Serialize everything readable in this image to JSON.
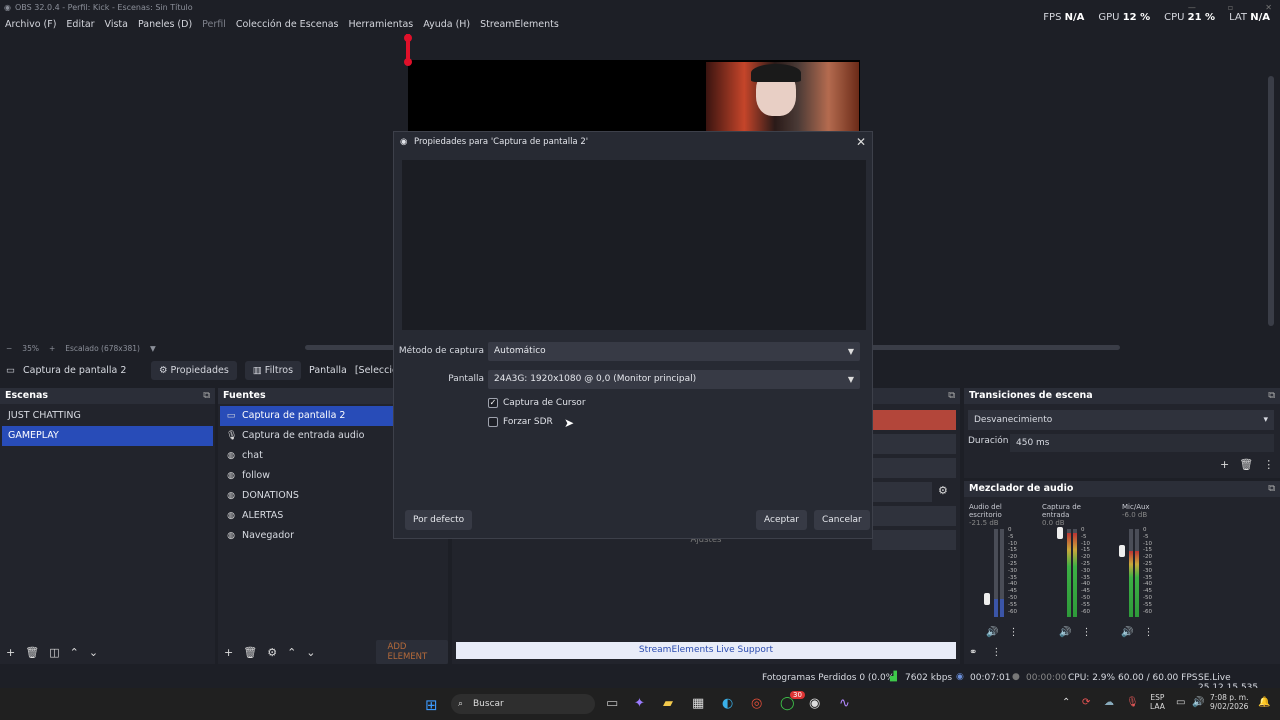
{
  "window": {
    "title": "OBS 32.0.4 - Perfil: Kick - Escenas: Sin Título"
  },
  "menu": [
    {
      "label": "Archivo (F)",
      "dim": false
    },
    {
      "label": "Editar",
      "dim": false
    },
    {
      "label": "Vista",
      "dim": false
    },
    {
      "label": "Paneles (D)",
      "dim": false
    },
    {
      "label": "Perfil",
      "dim": true
    },
    {
      "label": "Colección de Escenas",
      "dim": false
    },
    {
      "label": "Herramientas",
      "dim": false
    },
    {
      "label": "Ayuda (H)",
      "dim": false
    },
    {
      "label": "StreamElements",
      "dim": false
    }
  ],
  "stats": {
    "fps_label": "FPS",
    "fps": "N/A",
    "gpu_label": "GPU",
    "gpu": "12 %",
    "cpu_label": "CPU",
    "cpu": "21 %",
    "lat_label": "LAT",
    "lat": "N/A"
  },
  "zoom": {
    "minus": "−",
    "level": "35%",
    "plus": "+",
    "scale": "Escalado (678x381)"
  },
  "source_toolbar": {
    "source_name": "Captura de pantalla 2",
    "properties": "Propiedades",
    "filters": "Filtros",
    "display_label": "Pantalla",
    "display_value": "[Seleccionar pa"
  },
  "scenes": {
    "title": "Escenas",
    "items": [
      "JUST CHATTING",
      "GAMEPLAY"
    ],
    "selected": 1
  },
  "sources": {
    "title": "Fuentes",
    "items": [
      {
        "label": "Captura de pantalla 2",
        "icon": "monitor-icon"
      },
      {
        "label": "Captura de entrada audio",
        "icon": "mic-icon"
      },
      {
        "label": "chat",
        "icon": "globe-icon"
      },
      {
        "label": "follow",
        "icon": "globe-icon"
      },
      {
        "label": "DONATIONS",
        "icon": "globe-icon"
      },
      {
        "label": "ALERTAS",
        "icon": "globe-icon"
      },
      {
        "label": "Navegador",
        "icon": "globe-icon"
      }
    ],
    "add_element": "ADD ELEMENT"
  },
  "transitions": {
    "title": "Transiciones de escena",
    "selected": "Desvanecimiento",
    "duration_label": "Duración",
    "duration": "450 ms"
  },
  "mixer": {
    "title": "Mezclador de audio",
    "channels": [
      {
        "name": "Audio del escritorio",
        "db": "-21.5 dB",
        "level": 0.2
      },
      {
        "name": "Captura de entrada",
        "db": "0.0 dB",
        "level": 0.95
      },
      {
        "name": "Mic/Aux",
        "db": "-6.0 dB",
        "level": 0.75
      }
    ],
    "scale": [
      "0",
      "-5",
      "-10",
      "-15",
      "-20",
      "-25",
      "-30",
      "-35",
      "-40",
      "-45",
      "-50",
      "-55",
      "-60"
    ]
  },
  "controls": {
    "ajustes": "Ajustes",
    "support": "StreamElements Live Support"
  },
  "dialog": {
    "title": "Propiedades para 'Captura de pantalla 2'",
    "method_label": "Método de captura",
    "method_value": "Automático",
    "display_label": "Pantalla",
    "display_value": "24A3G: 1920x1080 @ 0,0 (Monitor principal)",
    "capture_cursor": "Captura de Cursor",
    "capture_cursor_checked": "✓",
    "force_sdr": "Forzar SDR",
    "defaults": "Por defecto",
    "accept": "Aceptar",
    "cancel": "Cancelar"
  },
  "status": {
    "dropped": "Fotogramas Perdidos 0 (0.0%)",
    "bitrate": "7602 kbps",
    "stream_time": "00:07:01",
    "rec_time": "00:00:00",
    "cpu": "CPU: 2.9%",
    "fps": "60.00 / 60.00 FPS",
    "version": "SE.Live 25.12.15.535"
  },
  "taskbar": {
    "search": "Buscar",
    "lang1": "ESP",
    "lang2": "LAA",
    "time": "7:08 p. m.",
    "date": "9/02/2026",
    "badge": "30"
  }
}
